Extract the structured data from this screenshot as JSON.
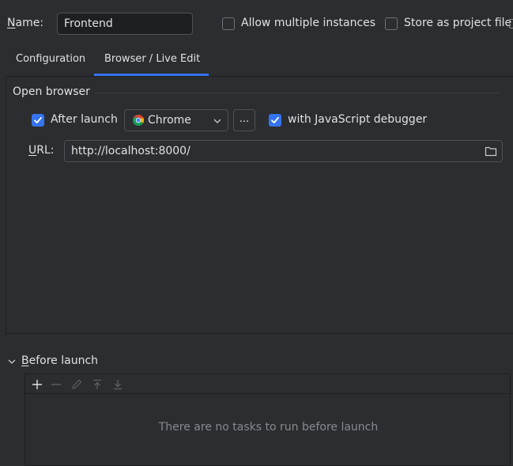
{
  "form": {
    "name_label_first": "N",
    "name_label_rest": "ame:",
    "name_value": "Frontend",
    "allow_multiple": {
      "label": "Allow multiple instances",
      "checked": false
    },
    "store_as_project": {
      "label": "Store as project file",
      "checked": false
    }
  },
  "tabs": [
    {
      "label": "Configuration",
      "active": false
    },
    {
      "label": "Browser / Live Edit",
      "active": true
    }
  ],
  "open_browser": {
    "title": "Open browser",
    "after_launch": {
      "label": "After launch",
      "checked": true
    },
    "browser_select": {
      "value": "Chrome",
      "icon": "chrome-icon"
    },
    "more_button": "...",
    "js_debugger": {
      "label": "with JavaScript debugger",
      "checked": true
    },
    "url_label_first": "U",
    "url_label_rest": "RL:",
    "url_value": "http://localhost:8000/"
  },
  "before_launch": {
    "title_first": "B",
    "title_rest": "efore launch",
    "empty_text": "There are no tasks to run before launch",
    "tools": [
      "add-icon",
      "remove-icon",
      "edit-icon",
      "move-up-icon",
      "move-down-icon"
    ]
  },
  "colors": {
    "accent": "#3574f0",
    "background": "#2b2d30",
    "field_background": "#1e1f22",
    "text": "#dfe1e5",
    "muted_text": "#868a91"
  }
}
